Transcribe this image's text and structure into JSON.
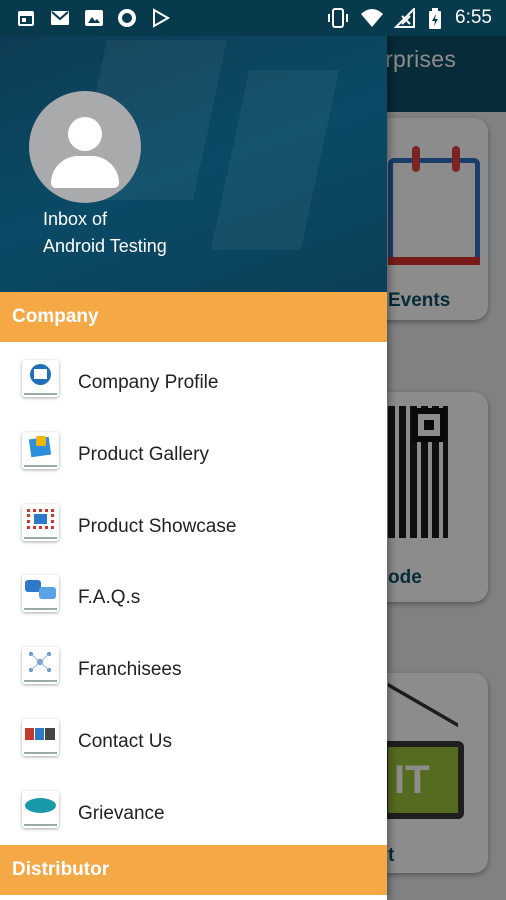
{
  "status_bar": {
    "time": "6:55",
    "left_icons": [
      "calendar-icon",
      "gmail-icon",
      "image-icon",
      "record-icon",
      "play-store-icon"
    ],
    "right_icons": [
      "vibrate-icon",
      "wifi-icon",
      "no-signal-icon",
      "battery-icon"
    ]
  },
  "background": {
    "title_fragment": "erprises",
    "card_labels": [
      "Events",
      "ode",
      "t"
    ],
    "exit_sign_text": "IT"
  },
  "drawer": {
    "account": {
      "line1": "Inbox of",
      "line2": "Android Testing"
    },
    "sections": {
      "company": "Company",
      "distributor": "Distributor"
    },
    "items": [
      {
        "label": "Company Profile",
        "icon": "company-profile-icon",
        "accent": "#1e6fb5"
      },
      {
        "label": "Product Gallery",
        "icon": "product-gallery-icon",
        "accent": "#2f8fdc"
      },
      {
        "label": "Product Showcase",
        "icon": "product-showcase-icon",
        "accent": "#d0342c"
      },
      {
        "label": "F.A.Q.s",
        "icon": "faq-icon",
        "accent": "#2e78c8"
      },
      {
        "label": "Franchisees",
        "icon": "franchisees-icon",
        "accent": "#5b8fd6"
      },
      {
        "label": "Contact Us",
        "icon": "contact-us-icon",
        "accent": "#c23a2e"
      },
      {
        "label": "Grievance",
        "icon": "grievance-icon",
        "accent": "#1a9aa8"
      }
    ]
  },
  "colors": {
    "header_bg": "#0a4a66",
    "section_bg": "#f5a846",
    "status_bar": "#083a4e",
    "app_bar": "#0d4f68"
  }
}
